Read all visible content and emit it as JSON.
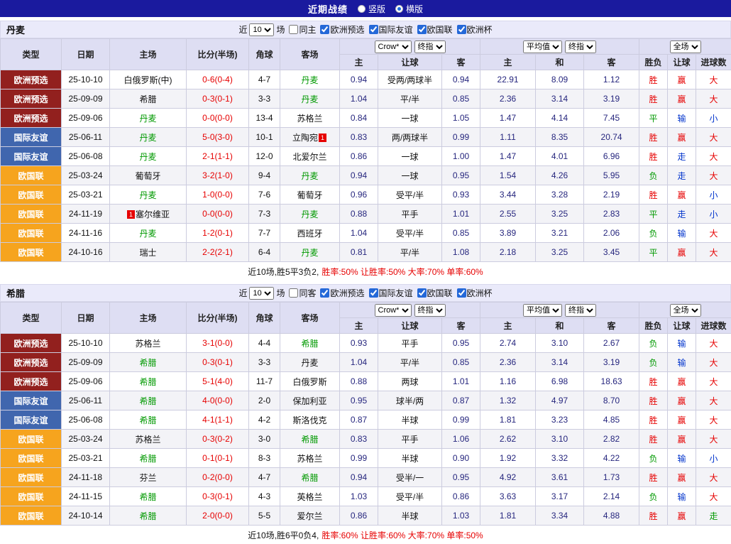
{
  "header": {
    "title": "近期战绩",
    "options": [
      {
        "label": "竖版",
        "selected": false
      },
      {
        "label": "横版",
        "selected": true
      }
    ]
  },
  "colors": {
    "topbar": "#1a1a9e",
    "euro_qualifier_tag": "#92201e",
    "friendly_tag": "#4066ae",
    "nations_league_tag": "#f6a41e",
    "focus_team": "#009900",
    "score": "#e60000",
    "win_red": "#e60000",
    "loss_green": "#009900",
    "lose_blue": "#0033cc"
  },
  "table": {
    "fixed_columns": [
      "类型",
      "日期",
      "主场",
      "比分(半场)",
      "角球",
      "客场"
    ],
    "sub_columns": [
      "主",
      "让球",
      "客",
      "主",
      "和",
      "客",
      "胜负",
      "让球",
      "进球数"
    ],
    "selects": {
      "bookmaker": "Crow*",
      "stage1": "终指",
      "average": "平均值",
      "stage2": "终指",
      "fulltime": "全场"
    }
  },
  "sections": [
    {
      "team": "丹麦",
      "filter": {
        "recent_label": "近",
        "count": "10",
        "matches_label": "场",
        "checkboxes": [
          {
            "name": "same-home",
            "label": "同主",
            "checked": false
          },
          {
            "name": "euro-qualifier",
            "label": "欧洲预选",
            "checked": true
          },
          {
            "name": "intl-friendly",
            "label": "国际友谊",
            "checked": true
          },
          {
            "name": "nations-league",
            "label": "欧国联",
            "checked": true
          },
          {
            "name": "euro-cup",
            "label": "欧洲杯",
            "checked": true
          }
        ]
      },
      "rows": [
        {
          "type": "欧洲预选",
          "tc": "pre",
          "date": "25-10-10",
          "home": "白俄罗斯(中)",
          "home_hl": false,
          "score": "0-6(0-4)",
          "corner": "4-7",
          "away": "丹麦",
          "away_hl": true,
          "o_h": "0.94",
          "hcap": "受两/两球半",
          "o_a": "0.94",
          "av_h": "22.91",
          "av_d": "8.09",
          "av_a": "1.12",
          "r1": [
            "胜",
            "r"
          ],
          "r2": [
            "赢",
            "r"
          ],
          "r3": [
            "大",
            "r"
          ]
        },
        {
          "type": "欧洲预选",
          "tc": "pre",
          "date": "25-09-09",
          "home": "希腊",
          "home_hl": false,
          "score": "0-3(0-1)",
          "corner": "3-3",
          "away": "丹麦",
          "away_hl": true,
          "o_h": "1.04",
          "hcap": "平/半",
          "o_a": "0.85",
          "av_h": "2.36",
          "av_d": "3.14",
          "av_a": "3.19",
          "r1": [
            "胜",
            "r"
          ],
          "r2": [
            "赢",
            "r"
          ],
          "r3": [
            "大",
            "r"
          ]
        },
        {
          "type": "欧洲预选",
          "tc": "pre",
          "date": "25-09-06",
          "home": "丹麦",
          "home_hl": true,
          "score": "0-0(0-0)",
          "corner": "13-4",
          "away": "苏格兰",
          "away_hl": false,
          "o_h": "0.84",
          "hcap": "一球",
          "o_a": "1.05",
          "av_h": "1.47",
          "av_d": "4.14",
          "av_a": "7.45",
          "r1": [
            "平",
            "g"
          ],
          "r2": [
            "输",
            "b"
          ],
          "r3": [
            "小",
            "b"
          ]
        },
        {
          "type": "国际友谊",
          "tc": "fri",
          "date": "25-06-11",
          "home": "丹麦",
          "home_hl": true,
          "score": "5-0(3-0)",
          "corner": "10-1",
          "away": "立陶宛",
          "away_hl": false,
          "away_badge": "1",
          "o_h": "0.83",
          "hcap": "两/两球半",
          "o_a": "0.99",
          "av_h": "1.11",
          "av_d": "8.35",
          "av_a": "20.74",
          "r1": [
            "胜",
            "r"
          ],
          "r2": [
            "赢",
            "r"
          ],
          "r3": [
            "大",
            "r"
          ]
        },
        {
          "type": "国际友谊",
          "tc": "fri",
          "date": "25-06-08",
          "home": "丹麦",
          "home_hl": true,
          "score": "2-1(1-1)",
          "corner": "12-0",
          "away": "北爱尔兰",
          "away_hl": false,
          "o_h": "0.86",
          "hcap": "一球",
          "o_a": "1.00",
          "av_h": "1.47",
          "av_d": "4.01",
          "av_a": "6.96",
          "r1": [
            "胜",
            "r"
          ],
          "r2": [
            "走",
            "b"
          ],
          "r3": [
            "大",
            "r"
          ]
        },
        {
          "type": "欧国联",
          "tc": "nat",
          "date": "25-03-24",
          "home": "葡萄牙",
          "home_hl": false,
          "score": "3-2(1-0)",
          "corner": "9-4",
          "away": "丹麦",
          "away_hl": true,
          "o_h": "0.94",
          "hcap": "一球",
          "o_a": "0.95",
          "av_h": "1.54",
          "av_d": "4.26",
          "av_a": "5.95",
          "r1": [
            "负",
            "g"
          ],
          "r2": [
            "走",
            "b"
          ],
          "r3": [
            "大",
            "r"
          ]
        },
        {
          "type": "欧国联",
          "tc": "nat",
          "date": "25-03-21",
          "home": "丹麦",
          "home_hl": true,
          "score": "1-0(0-0)",
          "corner": "7-6",
          "away": "葡萄牙",
          "away_hl": false,
          "o_h": "0.96",
          "hcap": "受平/半",
          "o_a": "0.93",
          "av_h": "3.44",
          "av_d": "3.28",
          "av_a": "2.19",
          "r1": [
            "胜",
            "r"
          ],
          "r2": [
            "赢",
            "r"
          ],
          "r3": [
            "小",
            "b"
          ]
        },
        {
          "type": "欧国联",
          "tc": "nat",
          "date": "24-11-19",
          "home": "塞尔维亚",
          "home_hl": false,
          "home_badge": "1",
          "score": "0-0(0-0)",
          "corner": "7-3",
          "away": "丹麦",
          "away_hl": true,
          "o_h": "0.88",
          "hcap": "平手",
          "o_a": "1.01",
          "av_h": "2.55",
          "av_d": "3.25",
          "av_a": "2.83",
          "r1": [
            "平",
            "g"
          ],
          "r2": [
            "走",
            "b"
          ],
          "r3": [
            "小",
            "b"
          ]
        },
        {
          "type": "欧国联",
          "tc": "nat",
          "date": "24-11-16",
          "home": "丹麦",
          "home_hl": true,
          "score": "1-2(0-1)",
          "corner": "7-7",
          "away": "西班牙",
          "away_hl": false,
          "o_h": "1.04",
          "hcap": "受平/半",
          "o_a": "0.85",
          "av_h": "3.89",
          "av_d": "3.21",
          "av_a": "2.06",
          "r1": [
            "负",
            "g"
          ],
          "r2": [
            "输",
            "b"
          ],
          "r3": [
            "大",
            "r"
          ]
        },
        {
          "type": "欧国联",
          "tc": "nat",
          "date": "24-10-16",
          "home": "瑞士",
          "home_hl": false,
          "score": "2-2(2-1)",
          "corner": "6-4",
          "away": "丹麦",
          "away_hl": true,
          "o_h": "0.81",
          "hcap": "平/半",
          "o_a": "1.08",
          "av_h": "2.18",
          "av_d": "3.25",
          "av_a": "3.45",
          "r1": [
            "平",
            "g"
          ],
          "r2": [
            "赢",
            "r"
          ],
          "r3": [
            "大",
            "r"
          ]
        }
      ],
      "summary": {
        "prefix": "近10场,胜5平3负2,",
        "rates": "胜率:50% 让胜率:50% 大率:70% 单率:60%"
      }
    },
    {
      "team": "希腊",
      "filter": {
        "recent_label": "近",
        "count": "10",
        "matches_label": "场",
        "checkboxes": [
          {
            "name": "same-away",
            "label": "同客",
            "checked": false
          },
          {
            "name": "euro-qualifier",
            "label": "欧洲预选",
            "checked": true
          },
          {
            "name": "intl-friendly",
            "label": "国际友谊",
            "checked": true
          },
          {
            "name": "nations-league",
            "label": "欧国联",
            "checked": true
          },
          {
            "name": "euro-cup",
            "label": "欧洲杯",
            "checked": true
          }
        ]
      },
      "rows": [
        {
          "type": "欧洲预选",
          "tc": "pre",
          "date": "25-10-10",
          "home": "苏格兰",
          "home_hl": false,
          "score": "3-1(0-0)",
          "corner": "4-4",
          "away": "希腊",
          "away_hl": true,
          "o_h": "0.93",
          "hcap": "平手",
          "o_a": "0.95",
          "av_h": "2.74",
          "av_d": "3.10",
          "av_a": "2.67",
          "r1": [
            "负",
            "g"
          ],
          "r2": [
            "输",
            "b"
          ],
          "r3": [
            "大",
            "r"
          ]
        },
        {
          "type": "欧洲预选",
          "tc": "pre",
          "date": "25-09-09",
          "home": "希腊",
          "home_hl": true,
          "score": "0-3(0-1)",
          "corner": "3-3",
          "away": "丹麦",
          "away_hl": false,
          "o_h": "1.04",
          "hcap": "平/半",
          "o_a": "0.85",
          "av_h": "2.36",
          "av_d": "3.14",
          "av_a": "3.19",
          "r1": [
            "负",
            "g"
          ],
          "r2": [
            "输",
            "b"
          ],
          "r3": [
            "大",
            "r"
          ]
        },
        {
          "type": "欧洲预选",
          "tc": "pre",
          "date": "25-09-06",
          "home": "希腊",
          "home_hl": true,
          "score": "5-1(4-0)",
          "corner": "11-7",
          "away": "白俄罗斯",
          "away_hl": false,
          "o_h": "0.88",
          "hcap": "两球",
          "o_a": "1.01",
          "av_h": "1.16",
          "av_d": "6.98",
          "av_a": "18.63",
          "r1": [
            "胜",
            "r"
          ],
          "r2": [
            "赢",
            "r"
          ],
          "r3": [
            "大",
            "r"
          ]
        },
        {
          "type": "国际友谊",
          "tc": "fri",
          "date": "25-06-11",
          "home": "希腊",
          "home_hl": true,
          "score": "4-0(0-0)",
          "corner": "2-0",
          "away": "保加利亚",
          "away_hl": false,
          "o_h": "0.95",
          "hcap": "球半/两",
          "o_a": "0.87",
          "av_h": "1.32",
          "av_d": "4.97",
          "av_a": "8.70",
          "r1": [
            "胜",
            "r"
          ],
          "r2": [
            "赢",
            "r"
          ],
          "r3": [
            "大",
            "r"
          ]
        },
        {
          "type": "国际友谊",
          "tc": "fri",
          "date": "25-06-08",
          "home": "希腊",
          "home_hl": true,
          "score": "4-1(1-1)",
          "corner": "4-2",
          "away": "斯洛伐克",
          "away_hl": false,
          "o_h": "0.87",
          "hcap": "半球",
          "o_a": "0.99",
          "av_h": "1.81",
          "av_d": "3.23",
          "av_a": "4.85",
          "r1": [
            "胜",
            "r"
          ],
          "r2": [
            "赢",
            "r"
          ],
          "r3": [
            "大",
            "r"
          ]
        },
        {
          "type": "欧国联",
          "tc": "nat",
          "date": "25-03-24",
          "home": "苏格兰",
          "home_hl": false,
          "score": "0-3(0-2)",
          "corner": "3-0",
          "away": "希腊",
          "away_hl": true,
          "o_h": "0.83",
          "hcap": "平手",
          "o_a": "1.06",
          "av_h": "2.62",
          "av_d": "3.10",
          "av_a": "2.82",
          "r1": [
            "胜",
            "r"
          ],
          "r2": [
            "赢",
            "r"
          ],
          "r3": [
            "大",
            "r"
          ]
        },
        {
          "type": "欧国联",
          "tc": "nat",
          "date": "25-03-21",
          "home": "希腊",
          "home_hl": true,
          "score": "0-1(0-1)",
          "corner": "8-3",
          "away": "苏格兰",
          "away_hl": false,
          "o_h": "0.99",
          "hcap": "半球",
          "o_a": "0.90",
          "av_h": "1.92",
          "av_d": "3.32",
          "av_a": "4.22",
          "r1": [
            "负",
            "g"
          ],
          "r2": [
            "输",
            "b"
          ],
          "r3": [
            "小",
            "b"
          ]
        },
        {
          "type": "欧国联",
          "tc": "nat",
          "date": "24-11-18",
          "home": "芬兰",
          "home_hl": false,
          "score": "0-2(0-0)",
          "corner": "4-7",
          "away": "希腊",
          "away_hl": true,
          "o_h": "0.94",
          "hcap": "受半/一",
          "o_a": "0.95",
          "av_h": "4.92",
          "av_d": "3.61",
          "av_a": "1.73",
          "r1": [
            "胜",
            "r"
          ],
          "r2": [
            "赢",
            "r"
          ],
          "r3": [
            "大",
            "r"
          ]
        },
        {
          "type": "欧国联",
          "tc": "nat",
          "date": "24-11-15",
          "home": "希腊",
          "home_hl": true,
          "score": "0-3(0-1)",
          "corner": "4-3",
          "away": "英格兰",
          "away_hl": false,
          "o_h": "1.03",
          "hcap": "受平/半",
          "o_a": "0.86",
          "av_h": "3.63",
          "av_d": "3.17",
          "av_a": "2.14",
          "r1": [
            "负",
            "g"
          ],
          "r2": [
            "输",
            "b"
          ],
          "r3": [
            "大",
            "r"
          ]
        },
        {
          "type": "欧国联",
          "tc": "nat",
          "date": "24-10-14",
          "home": "希腊",
          "home_hl": true,
          "score": "2-0(0-0)",
          "corner": "5-5",
          "away": "爱尔兰",
          "away_hl": false,
          "o_h": "0.86",
          "hcap": "半球",
          "o_a": "1.03",
          "av_h": "1.81",
          "av_d": "3.34",
          "av_a": "4.88",
          "r1": [
            "胜",
            "r"
          ],
          "r2": [
            "赢",
            "r"
          ],
          "r3": [
            "走",
            "g"
          ]
        }
      ],
      "summary": {
        "prefix": "近10场,胜6平0负4,",
        "rates": "胜率:60% 让胜率:60% 大率:70% 单率:50%"
      }
    }
  ]
}
